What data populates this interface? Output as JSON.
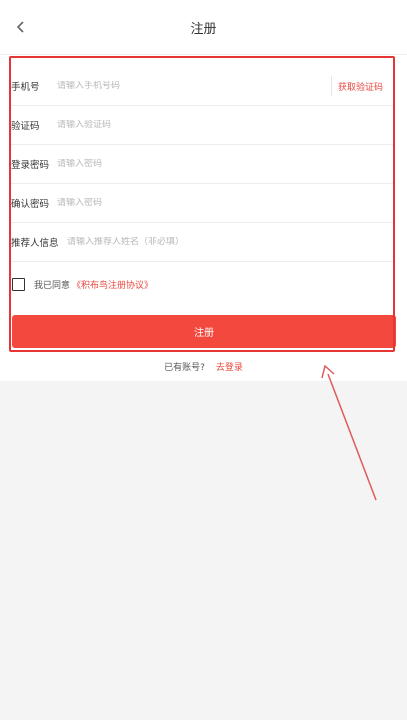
{
  "header": {
    "title": "注册"
  },
  "form": {
    "phone": {
      "label": "手机号",
      "placeholder": "请输入手机号码",
      "value": ""
    },
    "code": {
      "label": "验证码",
      "placeholder": "请输入验证码",
      "value": "",
      "button_label": "获取验证码"
    },
    "password": {
      "label": "登录密码",
      "placeholder": "请输入密码",
      "value": ""
    },
    "confirm": {
      "label": "确认密码",
      "placeholder": "请输入密码",
      "value": ""
    },
    "referrer": {
      "label": "推荐人信息",
      "placeholder": "请输入推荐人姓名（非必填）",
      "value": ""
    }
  },
  "agreement": {
    "prefix": "我已同意",
    "link": "《积布鸟注册协议》",
    "checked": false
  },
  "register_button": "注册",
  "login": {
    "prompt": "已有账号?",
    "link": "去登录"
  },
  "icons": {
    "back": "back-chevron-icon",
    "checkbox": "checkbox-icon",
    "annotation": "annotation-arrow-icon"
  },
  "colors": {
    "accent": "#f2483e",
    "highlight": "#e53535",
    "background": "#f4f4f4"
  }
}
